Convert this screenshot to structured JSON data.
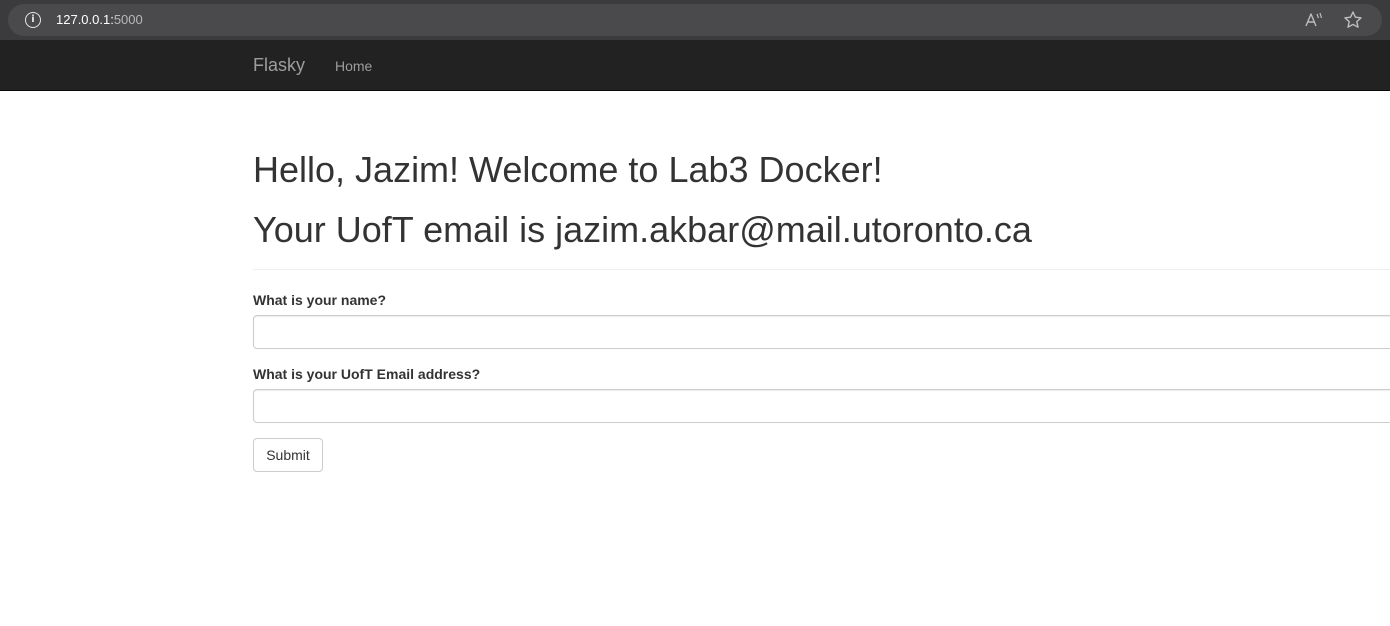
{
  "browser": {
    "url_host": "127.0.0.1:",
    "url_port": "5000",
    "info_icon": "info-icon",
    "read_aloud_icon": "read-aloud-icon",
    "favorite_icon": "star-outline-icon"
  },
  "navbar": {
    "brand": "Flasky",
    "links": [
      {
        "label": "Home"
      }
    ],
    "background": "#222222",
    "link_color": "#9d9d9d"
  },
  "main": {
    "greeting": "Hello, Jazim! Welcome to Lab3 Docker!",
    "email_line": "Your UofT email is jazim.akbar@mail.utoronto.ca",
    "form": {
      "name_label": "What is your name?",
      "name_value": "",
      "email_label": "What is your UofT Email address?",
      "email_value": "",
      "submit_label": "Submit"
    }
  }
}
